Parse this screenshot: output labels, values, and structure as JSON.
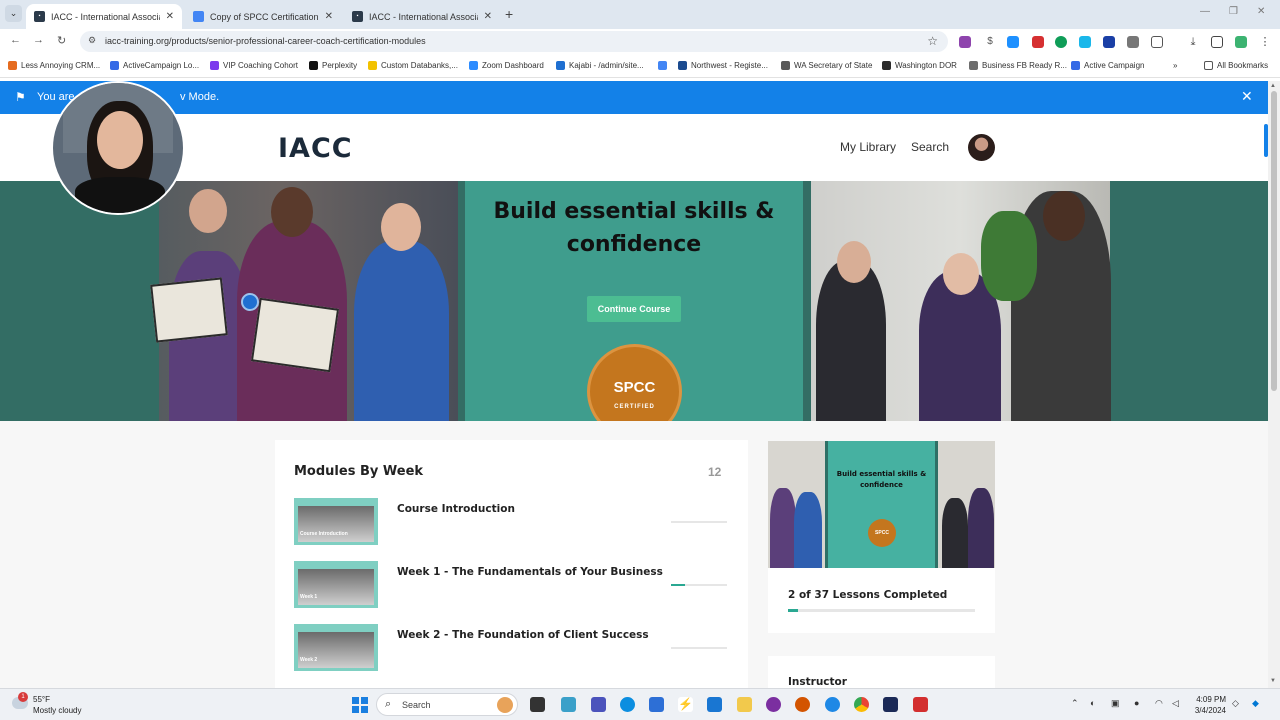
{
  "browser": {
    "tabs": [
      {
        "title": "IACC - International Association",
        "active": true,
        "favicon_color": "#2b3a4a"
      },
      {
        "title": "Copy of SPCC Certification Che",
        "active": false,
        "favicon_color": "#4285f4"
      },
      {
        "title": "IACC - International Association",
        "active": false,
        "favicon_color": "#2b3a4a"
      }
    ],
    "new_tab_label": "+",
    "url": "iacc-training.org/products/senior-professional-career-coach-certification-modules",
    "bookmarks": [
      {
        "label": "Less Annoying CRM...",
        "color": "#e56b1f"
      },
      {
        "label": "ActiveCampaign Lo...",
        "color": "#356ae6"
      },
      {
        "label": "VIP Coaching Cohort",
        "color": "#7c3aed"
      },
      {
        "label": "Perplexity",
        "color": "#111111"
      },
      {
        "label": "Custom Databanks,...",
        "color": "#f2c200"
      },
      {
        "label": "Zoom Dashboard",
        "color": "#2d8cff"
      },
      {
        "label": "Kajabi - /admin/site...",
        "color": "#1f6fd1"
      },
      {
        "label": "",
        "color": "#4285f4"
      },
      {
        "label": "Northwest - Registe...",
        "color": "#1b4b8f"
      },
      {
        "label": "WA Secretary of State",
        "color": "#5a5a5a"
      },
      {
        "label": "Washington DOR",
        "color": "#2b2b2b"
      },
      {
        "label": "Business FB Ready R...",
        "color": "#6d6d6d"
      },
      {
        "label": "Active Campaign",
        "color": "#356ae6"
      }
    ],
    "all_bookmarks_label": "All Bookmarks"
  },
  "banner": {
    "text_start": "You are",
    "text_end": "v Mode."
  },
  "site": {
    "logo": "IACC",
    "nav": {
      "library": "My Library",
      "search": "Search"
    }
  },
  "hero": {
    "title": "Build essential skills & confidence",
    "button_label": "Continue Course",
    "badge_main": "SPCC",
    "badge_sub": "CERTIFIED"
  },
  "modules": {
    "title": "Modules By Week",
    "count": "12",
    "items": [
      {
        "title": "Course Introduction",
        "thumb_label": "Course Introduction",
        "progress": 0
      },
      {
        "title": "Week 1 - The Fundamentals of Your Business",
        "thumb_label": "Week 1",
        "progress": 0.25
      },
      {
        "title": "Week 2 - The Foundation of Client Success",
        "thumb_label": "Week 2",
        "progress": 0
      }
    ]
  },
  "sidebar": {
    "thumb_title": "Build essential skills & confidence",
    "thumb_badge": "SPCC",
    "lessons_completed": "2 of 37 Lessons Completed",
    "lessons_progress": 0.054,
    "instructor_label": "Instructor"
  },
  "taskbar": {
    "weather_temp": "55°F",
    "weather_desc": "Mostly cloudy",
    "weather_badge": "1",
    "search_placeholder": "Search",
    "time": "4:09 PM",
    "date": "3/4/2024"
  },
  "colors": {
    "accent": "#2aa892",
    "banner": "#1381e8",
    "hero_bg": "#336d64",
    "button": "#4cbd92"
  }
}
